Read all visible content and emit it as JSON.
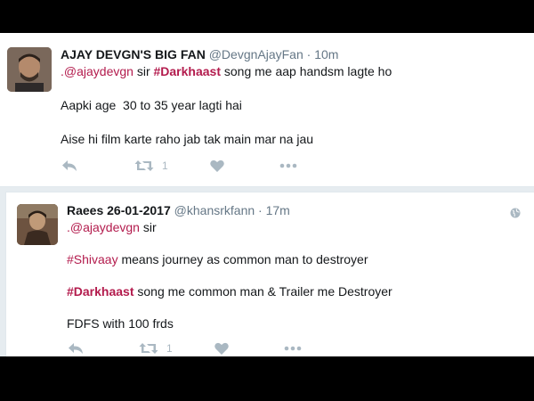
{
  "tweets": [
    {
      "display_name": "AJAY DEVGN'S BIG FAN",
      "handle": "@DevgnAjayFan",
      "time": "10m",
      "line1": {
        "mention": ".@ajaydevgn",
        "text_a": " sir ",
        "hashtag": "#Darkhaast",
        "text_b": " song me aap handsm lagte ho"
      },
      "line2": "Aapki age  30 to 35 year lagti hai",
      "line3": "Aise hi film karte raho jab tak main mar na jau",
      "retweet_count": "1"
    },
    {
      "display_name": "Raees 26-01-2017",
      "handle": "@khansrkfann",
      "time": "17m",
      "line1": {
        "mention": ".@ajaydevgn",
        "text_a": " sir"
      },
      "line2": {
        "hashtag": "#Shivaay",
        "text": " means journey as common man to destroyer"
      },
      "line3": {
        "hashtag": "#Darkhaast",
        "text": " song me common man & Trailer me Destroyer"
      },
      "line4": "FDFS with 100 frds",
      "retweet_count": "1"
    }
  ],
  "colors": {
    "link": "#b31b4d",
    "icon": "#aab8c2",
    "meta": "#657786"
  },
  "icons": [
    "reply-icon",
    "retweet-icon",
    "like-icon",
    "more-icon",
    "globe-icon"
  ]
}
